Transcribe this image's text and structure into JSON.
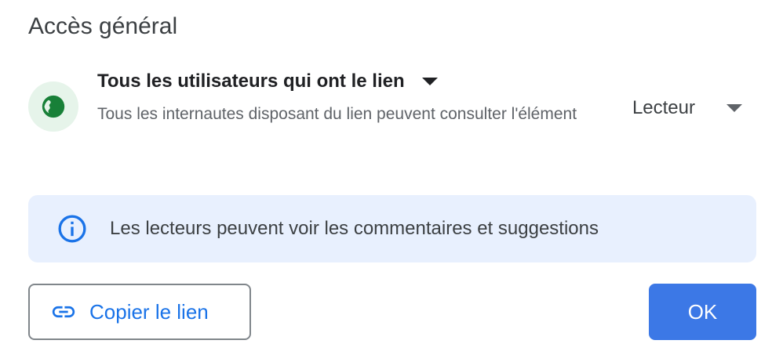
{
  "section": {
    "title": "Accès général"
  },
  "general_access": {
    "icon": "globe-icon",
    "selected_label": "Tous les utilisateurs qui ont le lien",
    "description": "Tous les internautes disposant du lien peuvent consulter l'élément",
    "role": "Lecteur"
  },
  "info_banner": {
    "icon": "info-icon",
    "text": "Les lecteurs peuvent voir les commentaires et suggestions"
  },
  "actions": {
    "copy_link_label": "Copier le lien",
    "copy_link_icon": "link-icon",
    "ok_label": "OK"
  },
  "colors": {
    "accent_blue": "#1a73e8",
    "ok_button_bg": "#3c78e6",
    "globe_bg": "#e6f4ea",
    "globe_fg": "#188038",
    "info_banner_bg": "#e8f0fe"
  }
}
